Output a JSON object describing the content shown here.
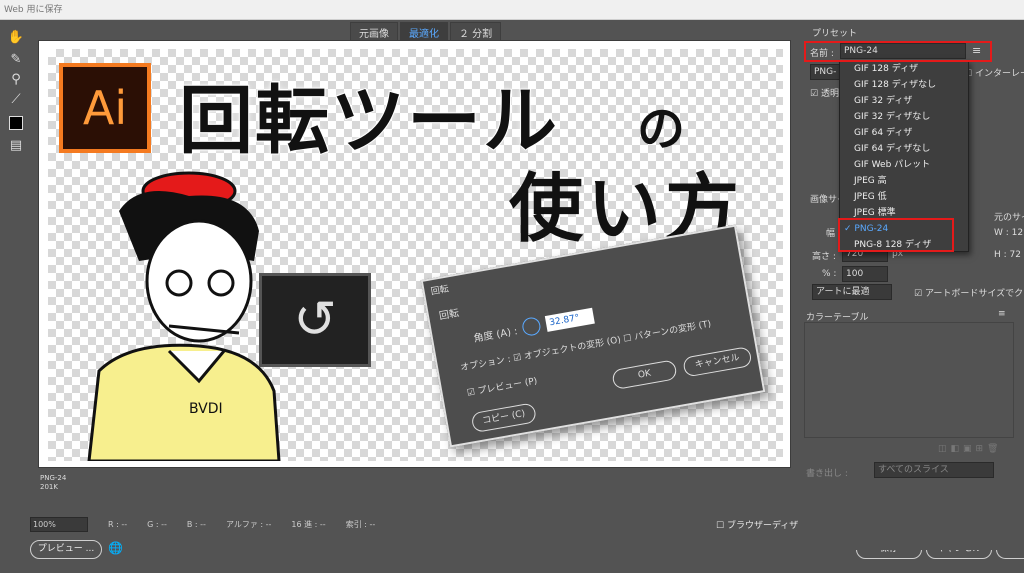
{
  "window": {
    "title": "Web 用に保存"
  },
  "tools": [
    "hand-icon",
    "slice-select-icon",
    "zoom-icon",
    "eyedropper-icon",
    "color-swatch",
    "toggle-slices-icon"
  ],
  "view_tabs": [
    {
      "label": "元画像",
      "active": false
    },
    {
      "label": "最適化",
      "active": true
    },
    {
      "label": "２ 分割",
      "active": false
    }
  ],
  "artwork": {
    "logo_text": "Ai",
    "headline_line1": "回転ツール",
    "headline_no": "の",
    "headline_line2": "使い方",
    "shirt_text": "BVDI"
  },
  "embedded_dialog": {
    "title": "回転",
    "group_label": "回転",
    "angle_label": "角度 (A) :",
    "angle_value": "32.87°",
    "option_text": "オプション :  ☑ オブジェクトの変形 (O)   ☐ パターンの変形 (T)",
    "preview_label": "プレビュー (P)",
    "copy_button": "コピー (C)",
    "ok_button": "OK",
    "cancel_button": "キャンセル"
  },
  "optimized_info": {
    "format": "PNG-24",
    "size": "201K"
  },
  "statusbar": {
    "zoom": "100%",
    "r": "R : --",
    "g": "G : --",
    "b": "B : --",
    "alpha": "アルファ : --",
    "hex": "16 進 : --",
    "index": "索引 : --"
  },
  "browser_dither": "ブラウザーディザ",
  "bottom_buttons": {
    "preview": "プレビュー ...",
    "save": "保存",
    "cancel": "キャンセル"
  },
  "panel": {
    "preset_title": "プリセット",
    "name_label": "名前 :",
    "name_value": "PNG-24",
    "format_value": "PNG-",
    "interlace": "インターレース",
    "transparency": "透明",
    "image_size_title": "画像サイ",
    "width_label": "幅 :",
    "height_label": "高さ :",
    "height_value": "720",
    "px": "px",
    "percent_label": "% :",
    "percent_value": "100",
    "original_size": "元のサイ",
    "orig_w_label": "W :",
    "orig_w": "12",
    "orig_h_label": "H :",
    "orig_h": "72",
    "fit_art": "アートに最適",
    "clip_artboard": "アートボードサイズでクリ",
    "color_table": "カラーテーブル",
    "export_label": "書き出し :",
    "export_value": "すべてのスライス"
  },
  "preset_dropdown": [
    {
      "label": "GIF 128 ディザ",
      "selected": false
    },
    {
      "label": "GIF 128 ディザなし",
      "selected": false
    },
    {
      "label": "GIF 32 ディザ",
      "selected": false
    },
    {
      "label": "GIF 32 ディザなし",
      "selected": false
    },
    {
      "label": "GIF 64 ディザ",
      "selected": false
    },
    {
      "label": "GIF 64 ディザなし",
      "selected": false
    },
    {
      "label": "GIF Web パレット",
      "selected": false
    },
    {
      "label": "JPEG 高",
      "selected": false
    },
    {
      "label": "JPEG 低",
      "selected": false
    },
    {
      "label": "JPEG 標準",
      "selected": false
    },
    {
      "label": "PNG-24",
      "selected": true
    },
    {
      "label": "PNG-8 128 ディザ",
      "selected": false
    }
  ],
  "colors": {
    "accent_red": "#e41a1a",
    "selected_blue": "#5aa9ff",
    "ai_orange": "#f47a20"
  }
}
